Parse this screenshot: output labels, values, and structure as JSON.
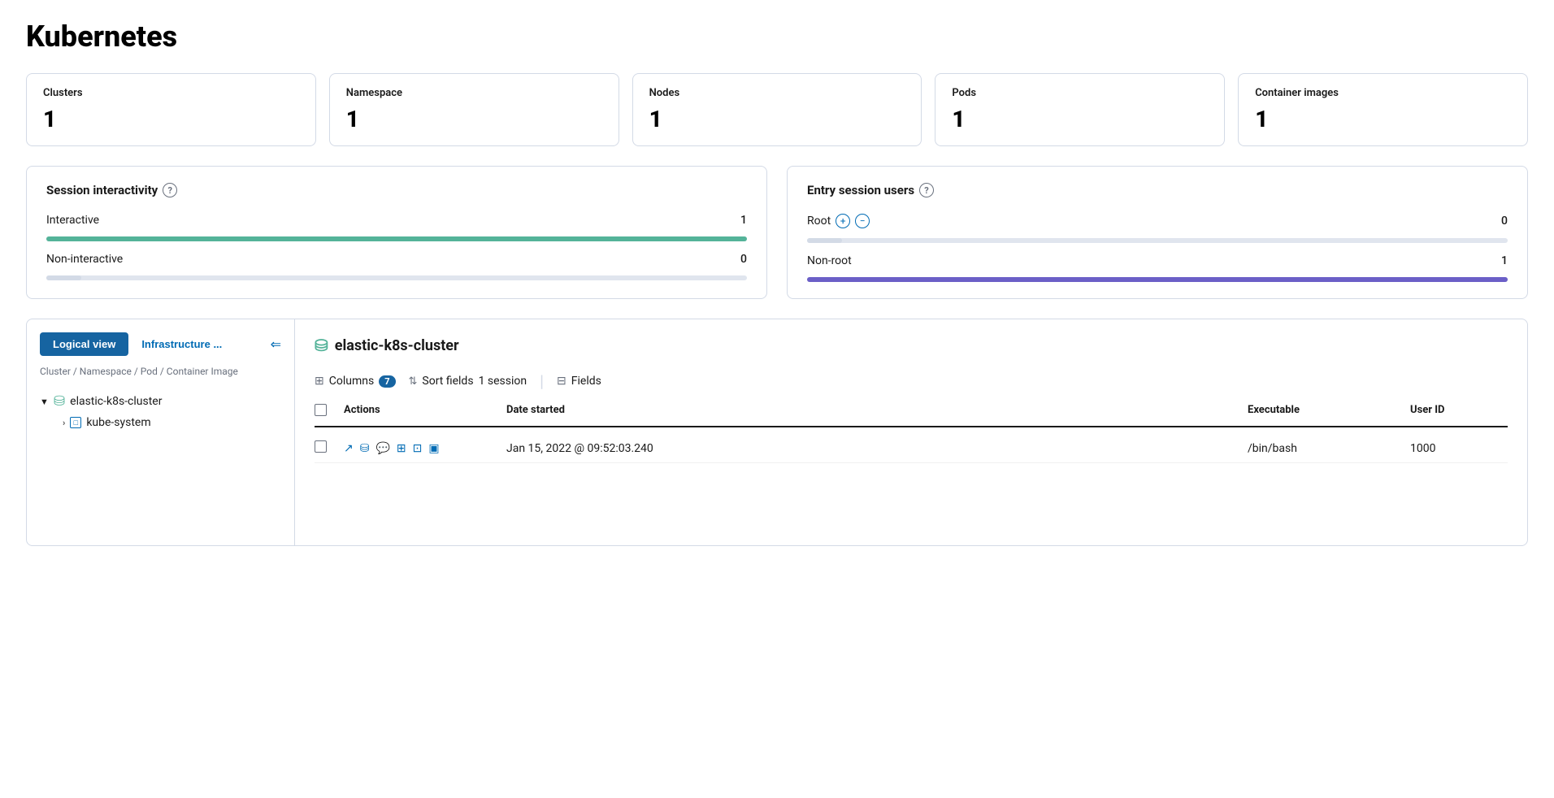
{
  "page": {
    "title": "Kubernetes"
  },
  "stats": [
    {
      "id": "clusters",
      "label": "Clusters",
      "value": "1"
    },
    {
      "id": "namespace",
      "label": "Namespace",
      "value": "1"
    },
    {
      "id": "nodes",
      "label": "Nodes",
      "value": "1"
    },
    {
      "id": "pods",
      "label": "Pods",
      "value": "1"
    },
    {
      "id": "container-images",
      "label": "Container images",
      "value": "1"
    }
  ],
  "session_interactivity": {
    "title": "Session interactivity",
    "rows": [
      {
        "label": "Interactive",
        "value": "1",
        "progress": 100,
        "color": "green"
      },
      {
        "label": "Non-interactive",
        "value": "0",
        "progress": 0,
        "color": "gray"
      }
    ]
  },
  "entry_session_users": {
    "title": "Entry session users",
    "rows": [
      {
        "label": "Root",
        "value": "0",
        "progress": 0,
        "color": "gray",
        "has_icons": true
      },
      {
        "label": "Non-root",
        "value": "1",
        "progress": 100,
        "color": "purple",
        "has_icons": false
      }
    ]
  },
  "left_panel": {
    "btn_logical": "Logical view",
    "btn_infra": "Infrastructure ...",
    "breadcrumb": "Cluster / Namespace / Pod / Container Image",
    "cluster_name": "elastic-k8s-cluster",
    "namespace_name": "kube-system"
  },
  "right_panel": {
    "cluster_header": "elastic-k8s-cluster",
    "toolbar": {
      "columns_label": "Columns",
      "columns_count": "7",
      "sort_label": "Sort fields",
      "sort_session": "1 session",
      "fields_label": "Fields"
    },
    "table": {
      "headers": [
        "",
        "Actions",
        "Date started",
        "Executable",
        "User ID"
      ],
      "rows": [
        {
          "date_started": "Jan 15, 2022 @ 09:52:03.240",
          "executable": "/bin/bash",
          "user_id": "1000"
        }
      ]
    }
  }
}
